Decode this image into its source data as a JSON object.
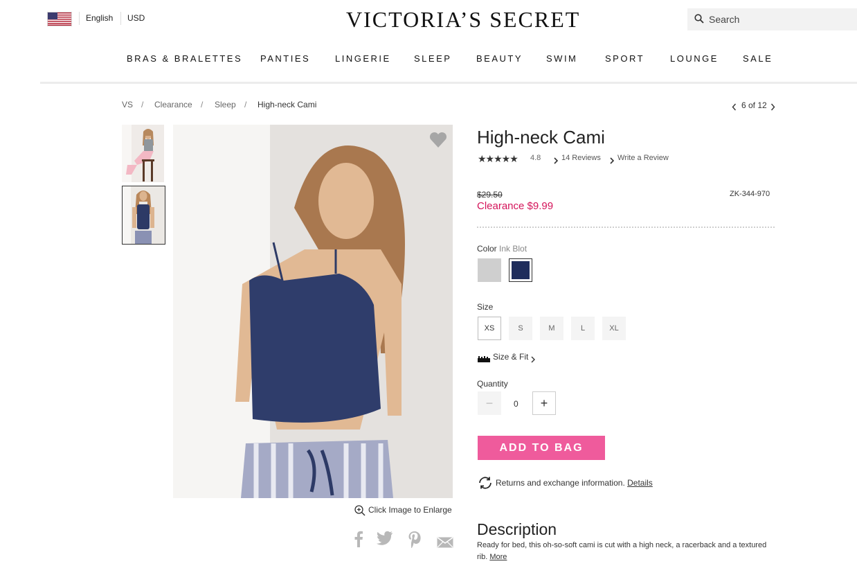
{
  "header": {
    "language": "English",
    "currency": "USD",
    "logo": "VICTORIA’S SECRET",
    "search_placeholder": "Search"
  },
  "nav": [
    "BRAS & BRALETTES",
    "PANTIES",
    "LINGERIE",
    "SLEEP",
    "BEAUTY",
    "SWIM",
    "SPORT",
    "LOUNGE",
    "SALE"
  ],
  "breadcrumb": [
    "VS",
    "Clearance",
    "Sleep",
    "High-neck Cami"
  ],
  "breadcrumb_separator": "/",
  "pager": "6 of 12",
  "product": {
    "title": "High-neck Cami",
    "rating": "4.8",
    "stars": 5,
    "reviews_link": "14 Reviews",
    "write_review": "Write a Review",
    "old_price": "$29.50",
    "sale_price": "Clearance $9.99",
    "sku": "ZK-344-970",
    "color_label": "Color",
    "color_value": "Ink Blot",
    "swatches": [
      "#cfcfcf",
      "#1f2d5c"
    ],
    "size_label": "Size",
    "sizes": [
      "XS",
      "S",
      "M",
      "L",
      "XL"
    ],
    "size_fit": "Size & Fit",
    "quantity_label": "Quantity",
    "quantity": "0",
    "qty_minus": "−",
    "qty_plus": "+",
    "add_to_bag": "ADD TO BAG",
    "returns_text": "Returns and exchange information.",
    "returns_link": "Details",
    "description_heading": "Description",
    "description_text": "Ready for bed, this oh-so-soft cami is cut with a high neck, a racerback and a textured rib.",
    "description_more": "More"
  },
  "gallery": {
    "enlarge_text": "Click Image to Enlarge"
  },
  "colors": {
    "accent_pink": "#ef5b9c",
    "sale_red": "#d4145a",
    "ink_blot": "#1f2d5c"
  }
}
